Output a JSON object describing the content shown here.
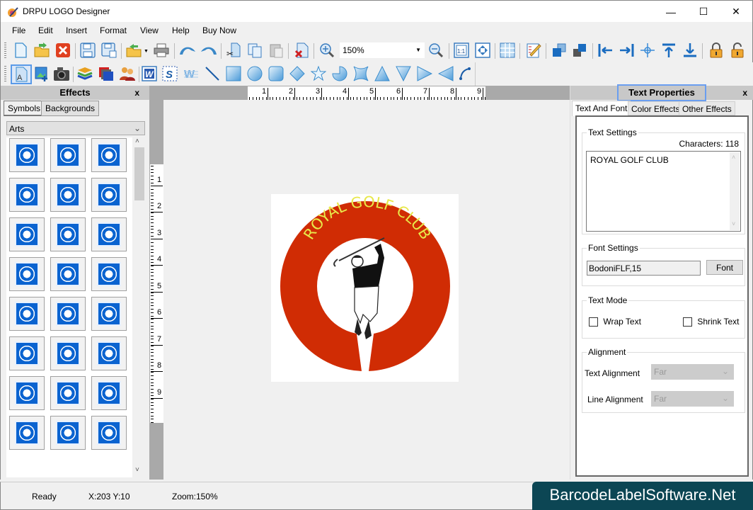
{
  "window": {
    "title": "DRPU LOGO Designer",
    "controls": {
      "minimize": "—",
      "maximize": "☐",
      "close": "✕"
    }
  },
  "menu": [
    "File",
    "Edit",
    "Insert",
    "Format",
    "View",
    "Help",
    "Buy Now"
  ],
  "toolbar1": {
    "icons": [
      "new-icon",
      "open-icon",
      "close-doc-icon",
      "save-icon",
      "save-as-icon",
      "open-recent-icon",
      "print-icon",
      "undo-icon",
      "redo-icon",
      "cut-icon",
      "copy-icon",
      "paste-icon",
      "delete-icon",
      "zoom-in-icon",
      "zoom-out-icon",
      "actual-size-icon",
      "fit-window-icon",
      "grid-icon",
      "edit-icon",
      "bring-front-icon",
      "send-back-icon",
      "align-left-icon",
      "align-right-icon",
      "align-center-icon",
      "align-top-icon",
      "align-bottom-icon",
      "lock-icon",
      "unlock-icon"
    ],
    "zoom_value": "150%"
  },
  "toolbar2": {
    "icons": [
      "text-icon",
      "insert-image-icon",
      "camera-icon",
      "layers-icon",
      "background-icon",
      "users-icon",
      "wordart-icon",
      "signature-icon",
      "watermark-icon",
      "line-icon",
      "rectangle-icon",
      "ellipse-icon",
      "rounded-rect-icon",
      "diamond-icon",
      "star-icon",
      "pie-icon",
      "cross-star-icon",
      "triangle-up-icon",
      "triangle-down-icon",
      "triangle-right-icon",
      "triangle-left-icon",
      "arc-icon"
    ]
  },
  "effects_panel": {
    "title": "Effects",
    "close": "x",
    "tabs": [
      "Symbols",
      "Backgrounds"
    ],
    "active_tab": "Symbols",
    "category": "Arts",
    "symbol_count_visible": 24,
    "scroll_up": "˄",
    "scroll_down": "˅"
  },
  "canvas": {
    "ruler_top": [
      "1",
      "2",
      "3",
      "4",
      "5",
      "6",
      "7",
      "8",
      "9"
    ],
    "ruler_left": [
      "1",
      "2",
      "3",
      "4",
      "5",
      "6",
      "7",
      "8",
      "9"
    ],
    "logo": {
      "text": "ROYAL GOLF CLUB",
      "ring_color": "#d02c04",
      "text_color": "#e8e84a"
    }
  },
  "text_properties": {
    "title": "Text Properties",
    "close": "x",
    "tabs": [
      "Text And Font",
      "Color Effects",
      "Other Effects"
    ],
    "active_tab": "Text And Font",
    "text_settings": {
      "label": "Text Settings",
      "characters_label": "Characters: 118",
      "text_value": "ROYAL GOLF CLUB"
    },
    "font_settings": {
      "label": "Font Settings",
      "font_value": "BodoniFLF,15",
      "font_button": "Font"
    },
    "text_mode": {
      "label": "Text Mode",
      "wrap_text": "Wrap Text",
      "wrap_checked": false,
      "shrink_text": "Shrink Text",
      "shrink_checked": false
    },
    "alignment": {
      "label": "Alignment",
      "text_alignment_label": "Text Alignment",
      "text_alignment_value": "Far",
      "line_alignment_label": "Line Alignment",
      "line_alignment_value": "Far"
    }
  },
  "status": {
    "state": "Ready",
    "coords": "X:203  Y:10",
    "zoom": "Zoom:150%"
  },
  "brand": "BarcodeLabelSoftware.Net"
}
